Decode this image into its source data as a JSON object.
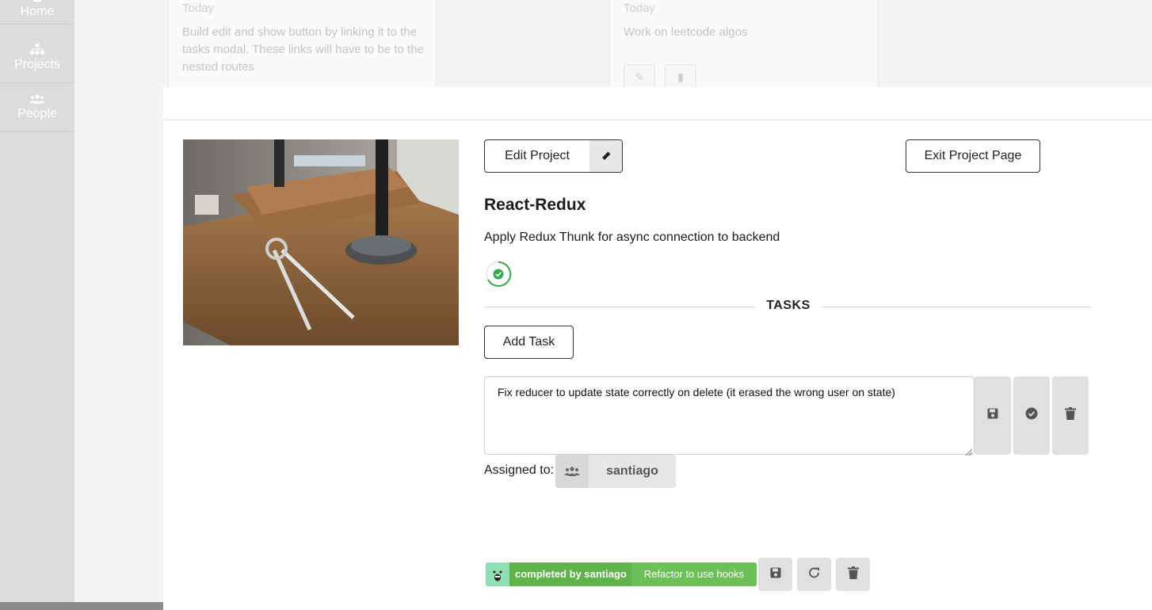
{
  "sidebar": {
    "items": [
      {
        "label": "Home",
        "icon": "home-icon"
      },
      {
        "label": "Projects",
        "icon": "sitemap-icon"
      },
      {
        "label": "People",
        "icon": "users-icon"
      }
    ]
  },
  "background": {
    "cards": [
      {
        "date": "Today",
        "text": "Build edit and show button by linking it to the tasks modal. These links will have to be to the nested routes"
      },
      {
        "date": "Today",
        "text": "Work on leetcode algos"
      }
    ]
  },
  "modal": {
    "edit_label": "Edit Project",
    "exit_label": "Exit Project Page",
    "project_title": "React-Redux",
    "project_description": "Apply Redux Thunk for async connection to backend",
    "tasks_heading": "TASKS",
    "add_task_label": "Add Task",
    "task_text": "Fix reducer to update state correctly on delete (it erased the wrong user on state)",
    "assigned_label": "Assigned to:",
    "assignee": "santiago",
    "completed": {
      "by_label": "completed by santiago",
      "task_label": "Refactor to use hooks"
    }
  },
  "colors": {
    "accent_green": "#5fb34a",
    "progress_green": "#3aa64f",
    "avatar_mint": "#8ee0b3"
  }
}
